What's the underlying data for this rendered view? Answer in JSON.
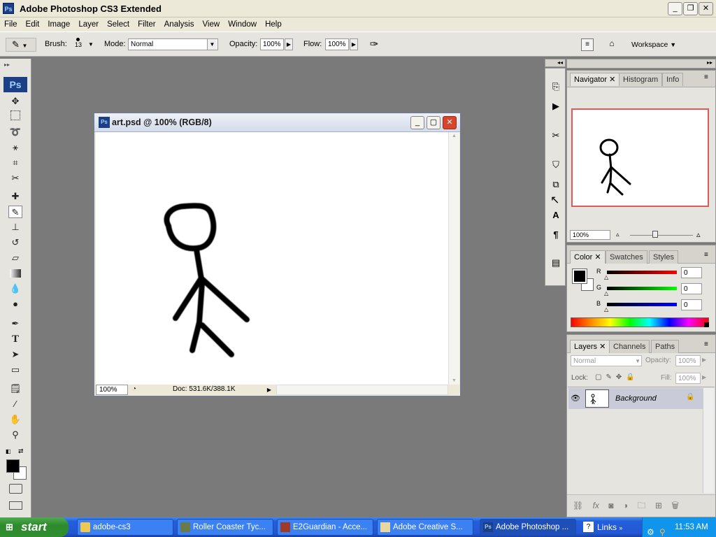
{
  "window": {
    "title": "Adobe Photoshop CS3 Extended",
    "app_icon": "Ps"
  },
  "menu": [
    "File",
    "Edit",
    "Image",
    "Layer",
    "Select",
    "Filter",
    "Analysis",
    "View",
    "Window",
    "Help"
  ],
  "options": {
    "brush_label": "Brush:",
    "brush_size": "13",
    "mode_label": "Mode:",
    "mode_value": "Normal",
    "opacity_label": "Opacity:",
    "opacity_value": "100%",
    "flow_label": "Flow:",
    "flow_value": "100%",
    "workspace_label": "Workspace"
  },
  "toolbox": {
    "ps_badge": "Ps",
    "tool_icons": [
      "move-icon",
      "marquee-icon",
      "lasso-icon",
      "magic-wand-icon",
      "crop-icon",
      "slice-icon",
      "healing-icon",
      "brush-icon",
      "stamp-icon",
      "history-brush-icon",
      "eraser-icon",
      "gradient-icon",
      "blur-icon",
      "dodge-icon",
      "pen-icon",
      "type-icon",
      "path-select-icon",
      "shape-icon",
      "notes-icon",
      "eyedropper-icon",
      "hand-icon",
      "zoom-icon"
    ],
    "foreground_color": "#000000",
    "background_color": "#ffffff"
  },
  "document": {
    "title": "art.psd @ 100% (RGB/8)",
    "zoom": "100%",
    "doc_info": "Doc: 531.6K/388.1K"
  },
  "navigator": {
    "tabs": [
      "Navigator",
      "Histogram",
      "Info"
    ],
    "zoom": "100%"
  },
  "color_panel": {
    "tabs": [
      "Color",
      "Swatches",
      "Styles"
    ],
    "channels": [
      {
        "label": "R",
        "value": "0",
        "color": "#cc0000"
      },
      {
        "label": "G",
        "value": "0",
        "color": "#00aa00"
      },
      {
        "label": "B",
        "value": "0",
        "color": "#0000cc"
      }
    ]
  },
  "layers_panel": {
    "tabs": [
      "Layers",
      "Channels",
      "Paths"
    ],
    "blend_mode": "Normal",
    "opacity_label": "Opacity:",
    "opacity_value": "100%",
    "lock_label": "Lock:",
    "fill_label": "Fill:",
    "fill_value": "100%",
    "layers": [
      {
        "name": "Background",
        "visible": true,
        "locked": true
      }
    ]
  },
  "taskbar": {
    "start_label": "start",
    "tasks": [
      {
        "label": "adobe-cs3",
        "active": false
      },
      {
        "label": "Roller Coaster Tyc...",
        "active": false
      },
      {
        "label": "E2Guardian - Acce...",
        "active": false
      },
      {
        "label": "Adobe Creative S...",
        "active": false
      },
      {
        "label": "Adobe Photoshop ...",
        "active": true
      }
    ],
    "links_label": "Links",
    "clock": "11:53 AM"
  }
}
